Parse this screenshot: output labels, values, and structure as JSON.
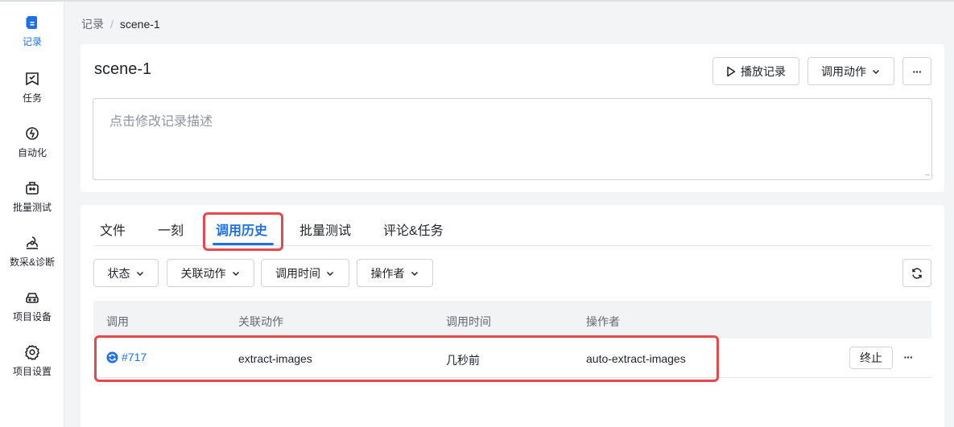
{
  "sidebar": {
    "items": [
      {
        "label": "记录",
        "icon": "record-icon",
        "active": true
      },
      {
        "label": "任务",
        "icon": "task-icon",
        "active": false
      },
      {
        "label": "自动化",
        "icon": "automation-icon",
        "active": false
      },
      {
        "label": "批量测试",
        "icon": "batch-test-icon",
        "active": false
      },
      {
        "label": "数采&诊断",
        "icon": "diagnosis-icon",
        "active": false
      },
      {
        "label": "项目设备",
        "icon": "device-icon",
        "active": false
      },
      {
        "label": "项目设置",
        "icon": "gear-icon",
        "active": false
      }
    ]
  },
  "breadcrumb": {
    "root": "记录",
    "separator": "/",
    "current": "scene-1"
  },
  "header": {
    "title": "scene-1",
    "play_label": "播放记录",
    "invoke_label": "调用动作",
    "more_label": "···",
    "description_placeholder": "点击修改记录描述",
    "grip": "..."
  },
  "tabs": [
    {
      "label": "文件"
    },
    {
      "label": "一刻"
    },
    {
      "label": "调用历史",
      "active": true
    },
    {
      "label": "批量测试"
    },
    {
      "label": "评论&任务"
    }
  ],
  "filters": [
    {
      "label": "状态"
    },
    {
      "label": "关联动作"
    },
    {
      "label": "调用时间"
    },
    {
      "label": "操作者"
    }
  ],
  "table": {
    "columns": [
      "调用",
      "关联动作",
      "调用时间",
      "操作者"
    ],
    "rows": [
      {
        "id": "#717",
        "action": "extract-images",
        "time": "几秒前",
        "operator": "auto-extract-images",
        "stop_label": "终止",
        "more_label": "···"
      }
    ]
  },
  "colors": {
    "accent": "#1f6fe5",
    "highlight": "#e5484d"
  }
}
